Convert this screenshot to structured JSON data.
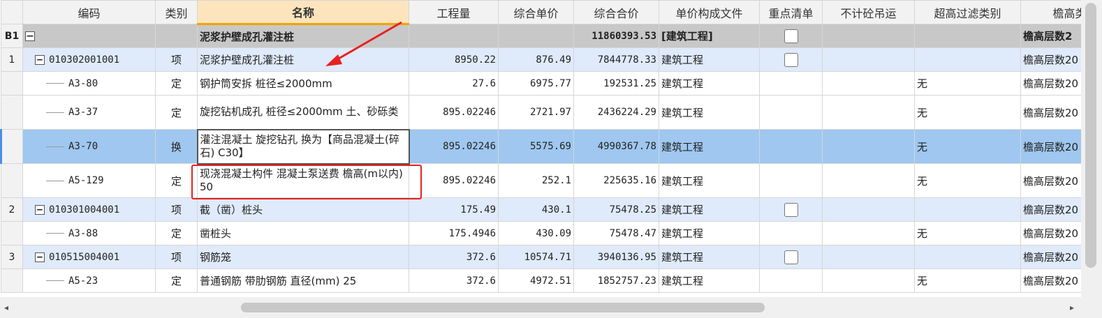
{
  "columns": [
    "",
    "编码",
    "类别",
    "名称",
    "工程量",
    "综合单价",
    "综合合价",
    "单价构成文件",
    "重点清单",
    "不计砼吊运",
    "超高过滤类别",
    "檐高类"
  ],
  "rows": [
    {
      "rowhead": "B1",
      "code": "",
      "type": "",
      "name": "泥浆护壁成孔灌注桩",
      "qty": "",
      "unit_price": "",
      "total": "11860393.53",
      "file": "[建筑工程]",
      "key_list": "",
      "no_pour": "",
      "filter": "",
      "eaves": "檐高层数2"
    },
    {
      "rowhead": "1",
      "code": "010302001001",
      "type": "项",
      "name": "泥浆护壁成孔灌注桩",
      "qty": "8950.22",
      "unit_price": "876.49",
      "total": "7844778.33",
      "file": "建筑工程",
      "key_list": "",
      "no_pour": "",
      "filter": "",
      "eaves": "檐高层数20"
    },
    {
      "rowhead": "",
      "code": "A3-80",
      "type": "定",
      "name": "钢护筒安拆 桩径≤2000mm",
      "qty": "27.6",
      "unit_price": "6975.77",
      "total": "192531.25",
      "file": "建筑工程",
      "key_list": "",
      "no_pour": "",
      "filter": "无",
      "eaves": "檐高层数20"
    },
    {
      "rowhead": "",
      "code": "A3-37",
      "type": "定",
      "name": "旋挖钻机成孔 桩径≤2000mm 土、砂砾类",
      "qty": "895.02246",
      "unit_price": "2721.97",
      "total": "2436224.29",
      "file": "建筑工程",
      "key_list": "",
      "no_pour": "",
      "filter": "无",
      "eaves": "檐高层数20"
    },
    {
      "rowhead": "",
      "code": "A3-70",
      "type": "换",
      "name": "灌注混凝土 旋挖钻孔  换为【商品混凝土(碎石) C30】",
      "qty": "895.02246",
      "unit_price": "5575.69",
      "total": "4990367.78",
      "file": "建筑工程",
      "key_list": "",
      "no_pour": "",
      "filter": "无",
      "eaves": "檐高层数20"
    },
    {
      "rowhead": "",
      "code": "A5-129",
      "type": "定",
      "name": "现浇混凝土构件 混凝土泵送费 檐高(m以内) 50",
      "qty": "895.02246",
      "unit_price": "252.1",
      "total": "225635.16",
      "file": "建筑工程",
      "key_list": "",
      "no_pour": "",
      "filter": "无",
      "eaves": "檐高层数20"
    },
    {
      "rowhead": "2",
      "code": "010301004001",
      "type": "项",
      "name": "截（凿）桩头",
      "qty": "175.49",
      "unit_price": "430.1",
      "total": "75478.25",
      "file": "建筑工程",
      "key_list": "",
      "no_pour": "",
      "filter": "",
      "eaves": "檐高层数20"
    },
    {
      "rowhead": "",
      "code": "A3-88",
      "type": "定",
      "name": "凿桩头",
      "qty": "175.4946",
      "unit_price": "430.09",
      "total": "75478.47",
      "file": "建筑工程",
      "key_list": "",
      "no_pour": "",
      "filter": "无",
      "eaves": "檐高层数20"
    },
    {
      "rowhead": "3",
      "code": "010515004001",
      "type": "项",
      "name": "钢筋笼",
      "qty": "372.6",
      "unit_price": "10574.71",
      "total": "3940136.95",
      "file": "建筑工程",
      "key_list": "",
      "no_pour": "",
      "filter": "",
      "eaves": "檐高层数20"
    },
    {
      "rowhead": "",
      "code": "A5-23",
      "type": "定",
      "name": "普通钢筋 带肋钢筋 直径(mm) 25",
      "qty": "372.6",
      "unit_price": "4972.51",
      "total": "1852757.23",
      "file": "建筑工程",
      "key_list": "",
      "no_pour": "",
      "filter": "无",
      "eaves": "檐高层数20"
    }
  ],
  "icons": {
    "expand": "minus-toggle-icon",
    "scroll_left": "◂",
    "scroll_right": "▸"
  }
}
